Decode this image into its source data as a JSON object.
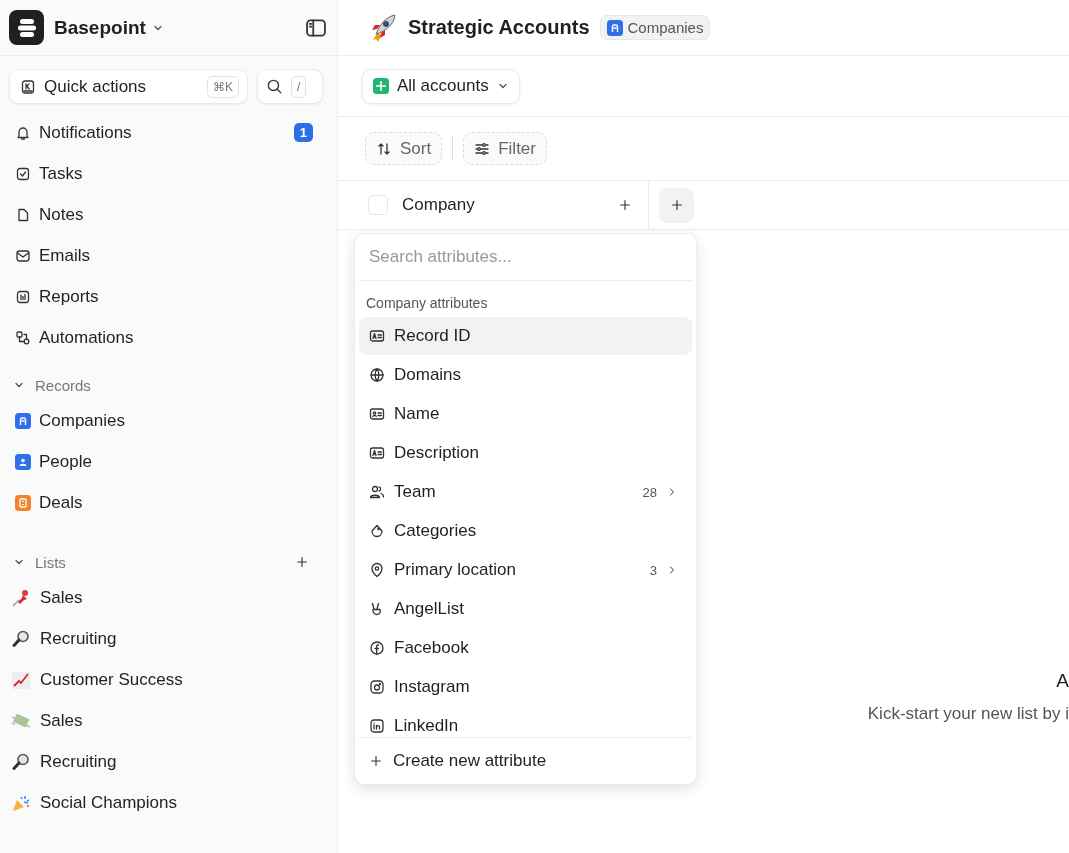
{
  "workspace": {
    "name": "Basepoint"
  },
  "quick_actions": {
    "label": "Quick actions",
    "shortcut": "⌘K",
    "search_shortcut": "/"
  },
  "nav": [
    {
      "label": "Notifications",
      "badge": "1"
    },
    {
      "label": "Tasks"
    },
    {
      "label": "Notes"
    },
    {
      "label": "Emails"
    },
    {
      "label": "Reports"
    },
    {
      "label": "Automations"
    }
  ],
  "records": {
    "title": "Records",
    "expanded": true,
    "items": [
      {
        "label": "Companies",
        "color": "#2f6fed"
      },
      {
        "label": "People",
        "color": "#2f6fed"
      },
      {
        "label": "Deals",
        "color": "#f5832a"
      }
    ]
  },
  "lists": {
    "title": "Lists",
    "expanded": true,
    "items": [
      {
        "label": "Sales"
      },
      {
        "label": "Recruiting"
      },
      {
        "label": "Customer Success"
      },
      {
        "label": "Sales"
      },
      {
        "label": "Recruiting"
      },
      {
        "label": "Social Champions"
      }
    ]
  },
  "page": {
    "title": "Strategic Accounts",
    "object_tag": "Companies"
  },
  "view": {
    "label": "All accounts"
  },
  "toolbar": [
    "Sort",
    "Filter"
  ],
  "table": {
    "select_all": {
      "checked": false
    },
    "columns": [
      "Company"
    ]
  },
  "attribute_menu": {
    "placeholder": "Search attributes...",
    "section": "Company attributes",
    "items": [
      {
        "label": "Record ID",
        "selected": true
      },
      {
        "label": "Domains",
        "selected": false
      },
      {
        "label": "Name",
        "selected": false
      },
      {
        "label": "Description",
        "selected": false
      },
      {
        "label": "Team",
        "count": "28",
        "selected": false
      },
      {
        "label": "Categories",
        "selected": false
      },
      {
        "label": "Primary location",
        "count": "3",
        "selected": false
      },
      {
        "label": "AngelList",
        "selected": false
      },
      {
        "label": "Facebook",
        "selected": false
      },
      {
        "label": "Instagram",
        "selected": false
      },
      {
        "label": "LinkedIn",
        "selected": false
      }
    ],
    "create": "Create new attribute"
  },
  "empty_state": {
    "title": "A",
    "text": "Kick-start your new list by i"
  }
}
